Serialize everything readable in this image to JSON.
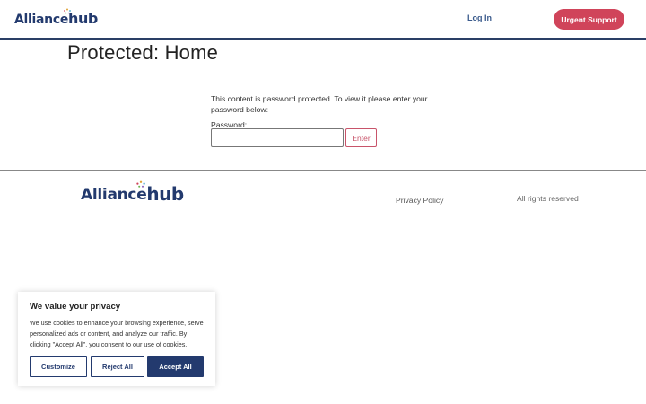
{
  "header": {
    "logo": {
      "part1": "Alliance",
      "part2": "hub"
    },
    "login_label": "Log In",
    "urgent_label": "Urgent Support"
  },
  "main": {
    "title": "Protected: Home",
    "message": "This content is password protected. To view it please enter your password below:",
    "password_label": "Password:",
    "password_value": "",
    "enter_label": "Enter"
  },
  "footer": {
    "logo": {
      "part1": "Alliance",
      "part2": "hub"
    },
    "privacy_label": "Privacy Policy",
    "rights_text": "All rights reserved"
  },
  "cookie": {
    "title": "We value your privacy",
    "text": "We use cookies to enhance your browsing experience, serve personalized ads or content, and analyze our traffic. By clicking \"Accept All\", you consent to our use of cookies.",
    "customize_label": "Customize",
    "reject_label": "Reject All",
    "accept_label": "Accept All"
  },
  "colors": {
    "brand_navy": "#233a6e",
    "urgent_red": "#d0445a",
    "enter_accent": "#c8546a"
  }
}
